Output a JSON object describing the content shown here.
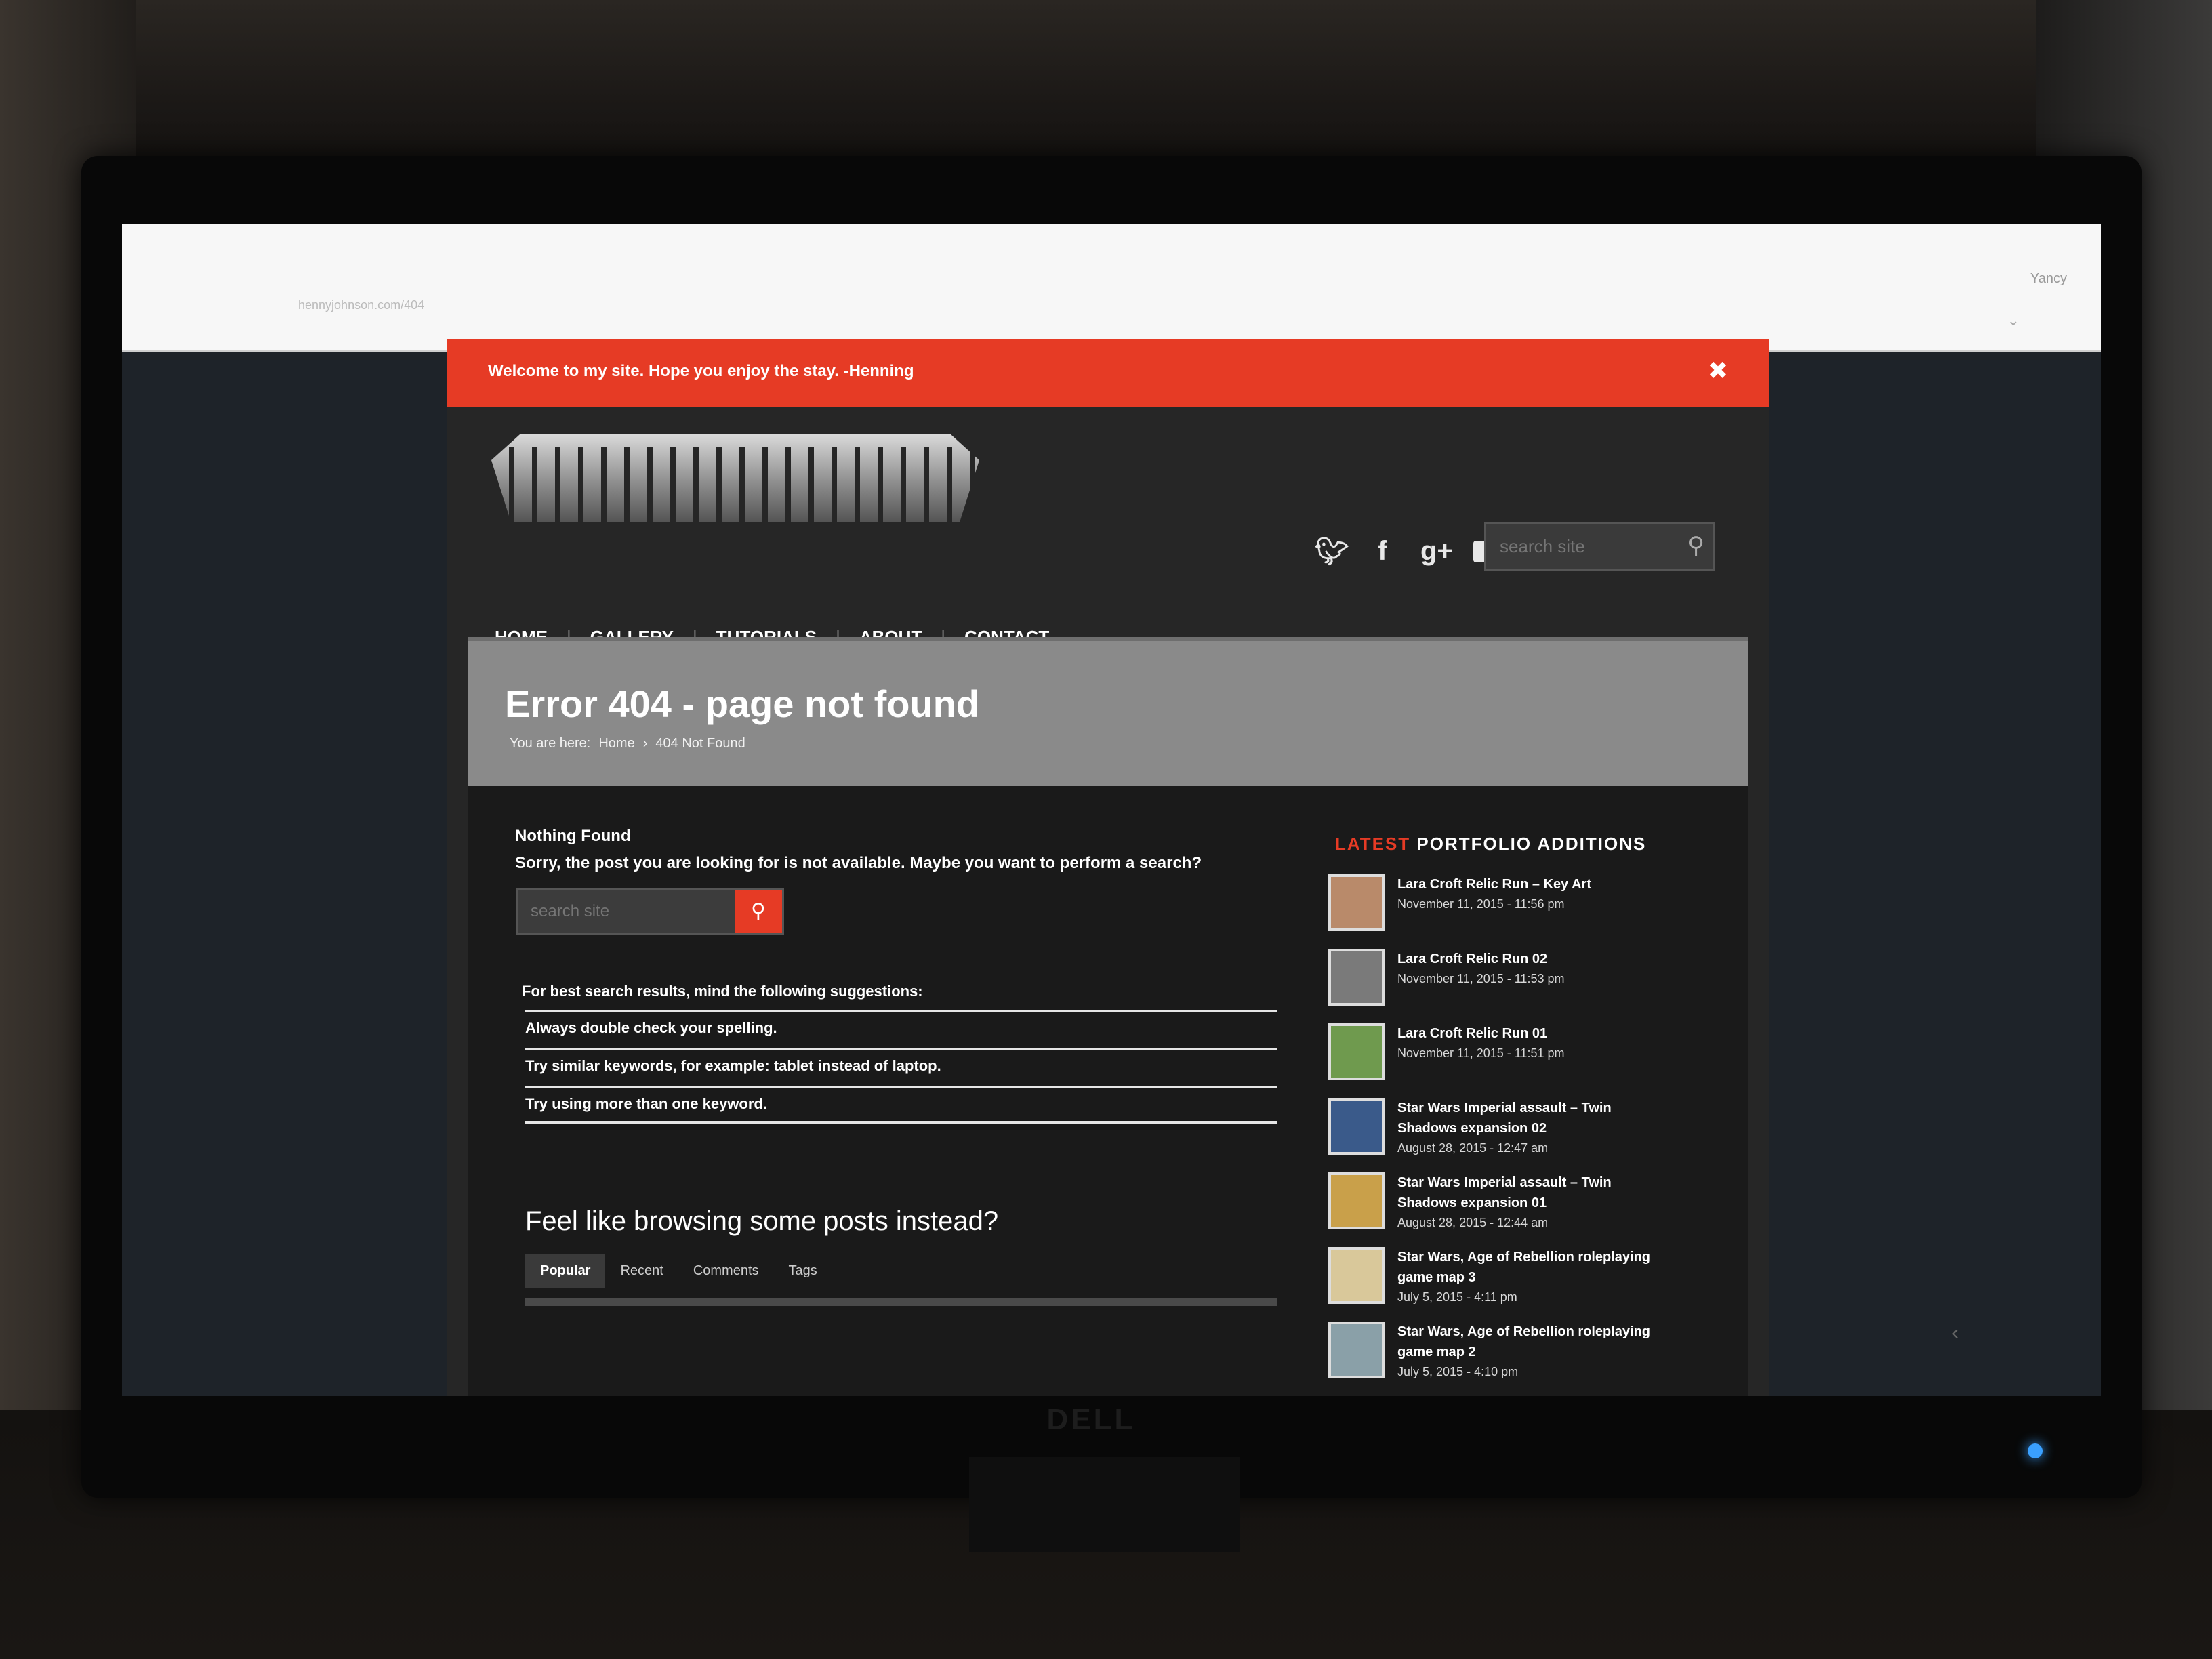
{
  "browser": {
    "user": "Yancy",
    "address": "hennyjohnson.com/404"
  },
  "notice": {
    "text": "Welcome to my site. Hope you enjoy the stay. -Henning",
    "close_icon": "close-icon"
  },
  "header": {
    "social_icons": [
      "twitter-icon",
      "facebook-icon",
      "google-plus-icon",
      "mail-icon"
    ],
    "search_placeholder": "search site"
  },
  "nav": {
    "items": [
      "HOME",
      "GALLERY",
      "TUTORIALS",
      "ABOUT",
      "CONTACT"
    ]
  },
  "title_band": {
    "title": "Error 404 - page not found",
    "breadcrumb_prefix": "You are here:",
    "breadcrumb_home": "Home",
    "breadcrumb_sep": "›",
    "breadcrumb_current": "404 Not Found"
  },
  "main": {
    "nothing_title": "Nothing Found",
    "nothing_text": "Sorry, the post you are looking for is not available. Maybe you want to perform a search?",
    "search_placeholder": "search site",
    "suggest_title": "For best search results, mind the following suggestions:",
    "suggestions": [
      "Always double check your spelling.",
      "Try similar keywords, for example: tablet instead of laptop.",
      "Try using more than one keyword."
    ],
    "browse_title": "Feel like browsing some posts instead?",
    "tabs": [
      "Popular",
      "Recent",
      "Comments",
      "Tags"
    ]
  },
  "sidebar": {
    "title_accent": "LATEST",
    "title_rest": "PORTFOLIO ADDITIONS",
    "items": [
      {
        "title": "Lara Croft Relic Run – Key Art",
        "date": "November 11, 2015 - 11:56 pm",
        "color": "#b98a6a"
      },
      {
        "title": "Lara Croft Relic Run 02",
        "date": "November 11, 2015 - 11:53 pm",
        "color": "#7a7a7a"
      },
      {
        "title": "Lara Croft Relic Run 01",
        "date": "November 11, 2015 - 11:51 pm",
        "color": "#6f9a4e"
      },
      {
        "title": "Star Wars Imperial assault – Twin Shadows expansion 02",
        "date": "August 28, 2015 - 12:47 am",
        "color": "#3a5a8a"
      },
      {
        "title": "Star Wars Imperial assault – Twin Shadows expansion 01",
        "date": "August 28, 2015 - 12:44 am",
        "color": "#c9a04a"
      },
      {
        "title": "Star Wars, Age of Rebellion roleplaying game map 3",
        "date": "July 5, 2015 - 4:11 pm",
        "color": "#d9c89a"
      },
      {
        "title": "Star Wars, Age of Rebellion roleplaying game map 2",
        "date": "July 5, 2015 - 4:10 pm",
        "color": "#8aa0a8"
      }
    ]
  },
  "monitor": {
    "brand": "DELL"
  }
}
